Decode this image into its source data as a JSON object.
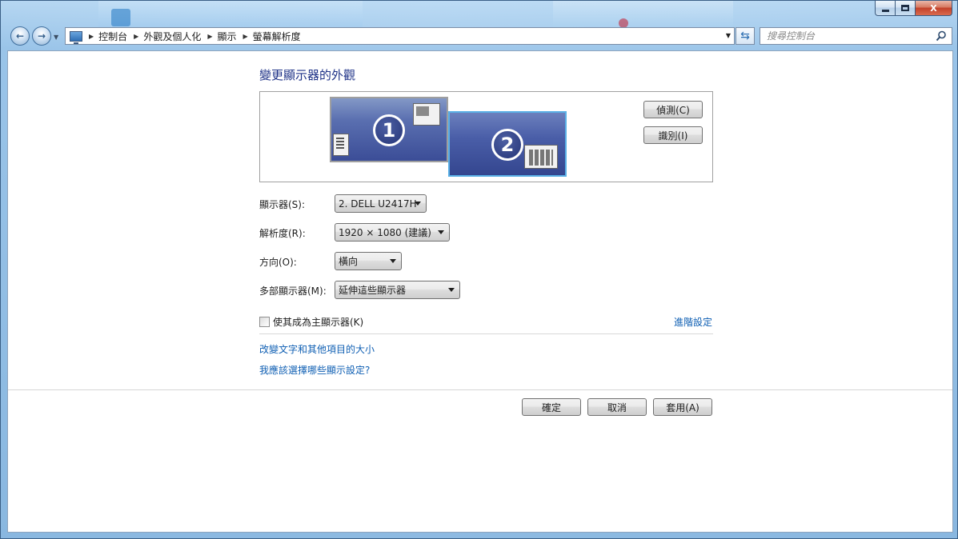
{
  "window": {
    "minimize_glyph": "–",
    "maximize_glyph": "□",
    "close_glyph": "X"
  },
  "navigation": {
    "back_glyph": "←",
    "forward_glyph": "→",
    "breadcrumbs": [
      "控制台",
      "外觀及個人化",
      "顯示",
      "螢幕解析度"
    ],
    "search_placeholder": "搜尋控制台"
  },
  "page": {
    "heading": "變更顯示器的外觀",
    "monitors": [
      {
        "number": "1",
        "selected": false
      },
      {
        "number": "2",
        "selected": true
      }
    ],
    "detect_button": "偵測(C)",
    "identify_button": "識別(I)",
    "settings": {
      "display_label": "顯示器(S):",
      "display_value": "2. DELL U2417H",
      "resolution_label": "解析度(R):",
      "resolution_value": "1920 × 1080 (建議)",
      "orientation_label": "方向(O):",
      "orientation_value": "橫向",
      "multiple_displays_label": "多部顯示器(M):",
      "multiple_displays_value": "延伸這些顯示器"
    },
    "make_main_label": "使其成為主顯示器(K)",
    "make_main_checked": false,
    "advanced_link": "進階設定",
    "links": [
      "改變文字和其他項目的大小",
      "我應該選擇哪些顯示設定?"
    ]
  },
  "footer": {
    "ok_button": "確定",
    "cancel_button": "取消",
    "apply_button": "套用(A)"
  },
  "colors": {
    "heading": "#1e3287",
    "link": "#0f5fb3",
    "selected_monitor_border": "#5ab0e6"
  }
}
